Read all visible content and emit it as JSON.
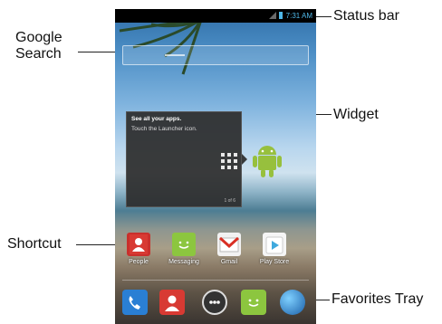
{
  "callouts": {
    "status_bar": "Status bar",
    "google_search": "Google\nSearch",
    "widget": "Widget",
    "shortcut": "Shortcut",
    "favorites_tray": "Favorites Tray"
  },
  "statusbar": {
    "time": "7:31 AM"
  },
  "widget": {
    "title": "See all your apps.",
    "text": "Touch the Launcher icon.",
    "page": "1 of 6"
  },
  "shortcuts": [
    {
      "label": "People",
      "icon": "people-icon"
    },
    {
      "label": "Messaging",
      "icon": "messaging-icon"
    },
    {
      "label": "Gmail",
      "icon": "gmail-icon"
    },
    {
      "label": "Play Store",
      "icon": "play-store-icon"
    }
  ],
  "tray": [
    "phone-icon",
    "contacts-icon",
    "launcher-icon",
    "messaging-icon",
    "browser-icon"
  ]
}
